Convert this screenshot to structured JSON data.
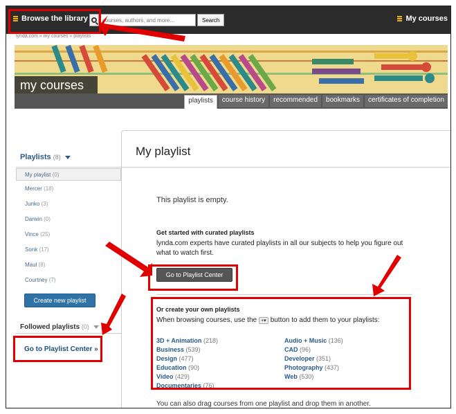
{
  "topbar": {
    "browse_label": "Browse the library",
    "search_placeholder": "courses, authors, and more...",
    "search_button": "Search",
    "mycourses_label": "My courses"
  },
  "breadcrumb": "lynda.com » my courses » playlists",
  "banner": {
    "title": "my courses",
    "tabs": [
      "playlists",
      "course history",
      "recommended",
      "bookmarks",
      "certificates of completion"
    ]
  },
  "sidebar": {
    "playlists_label": "Playlists",
    "playlists_count": "(8)",
    "playlists": [
      {
        "name": "My playlist",
        "count": "(0)"
      },
      {
        "name": "Mercer",
        "count": "(18)"
      },
      {
        "name": "Junko",
        "count": "(3)"
      },
      {
        "name": "Darwin",
        "count": "(0)"
      },
      {
        "name": "Vince",
        "count": "(25)"
      },
      {
        "name": "Sonk",
        "count": "(17)"
      },
      {
        "name": "Maul",
        "count": "(8)"
      },
      {
        "name": "Courtney",
        "count": "(7)"
      }
    ],
    "new_playlist_button": "Create new playlist",
    "followed_label": "Followed playlists",
    "followed_count": "(0)",
    "goto_link": "Go to Playlist Center »"
  },
  "main": {
    "title": "My playlist",
    "empty_text": "This playlist is empty.",
    "curated_heading": "Get started with curated playlists",
    "curated_text": "lynda.com experts have curated playlists in all our subjects to help you figure out what to watch first.",
    "goto_button": "Go to Playlist Center",
    "own_heading": "Or create your own playlists",
    "own_text_before": "When browsing courses, use the",
    "plus_badge": "+▾",
    "own_text_after": "button to add them to your playlists:",
    "subjects": [
      {
        "name": "3D + Animation",
        "count": "(218)"
      },
      {
        "name": "Business",
        "count": "(539)"
      },
      {
        "name": "Design",
        "count": "(477)"
      },
      {
        "name": "Education",
        "count": "(90)"
      },
      {
        "name": "Video",
        "count": "(429)"
      },
      {
        "name": "Documentaries",
        "count": "(76)"
      },
      {
        "name": "Audio + Music",
        "count": "(136)"
      },
      {
        "name": "CAD",
        "count": "(96)"
      },
      {
        "name": "Developer",
        "count": "(351)"
      },
      {
        "name": "Photography",
        "count": "(437)"
      },
      {
        "name": "Web",
        "count": "(530)"
      }
    ],
    "drag_note": "You can also drag courses from one playlist and drop them in another."
  },
  "colors": {
    "highlight": "#e00000",
    "link": "#2a5a8a",
    "primary_button": "#2f73a6",
    "topbar": "#2b2b2b"
  }
}
